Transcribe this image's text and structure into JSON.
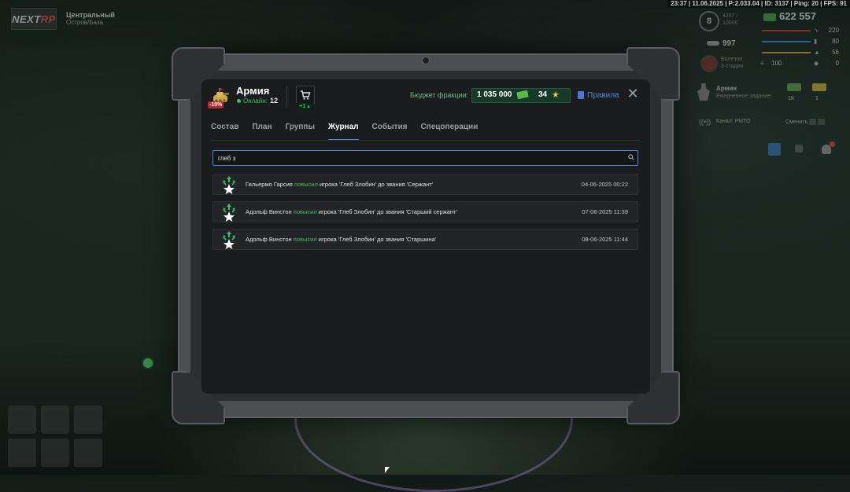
{
  "hud": {
    "top_strip": "23:37 | 11.06.2025 | P:2.033.04 | ID: 3137 | Ping: 20 | FPS: 91",
    "logo_main": "NEXT",
    "logo_accent": "RP",
    "zone_title": "Центральный",
    "zone_sub": "Остров/База",
    "level": "8",
    "xp_line1": "4207 /",
    "xp_line2": "10000",
    "money": "622 557",
    "rating": "997",
    "wanted_line1": "Болезни:",
    "wanted_line2": "3 стадия",
    "ammo": "100",
    "stats": [
      {
        "value": "220",
        "color": "#c43b3b",
        "icon": "heart-pulse-icon"
      },
      {
        "value": "80",
        "color": "#3b8fd0",
        "icon": "shield-bars-icon"
      },
      {
        "value": "56",
        "color": "#d0a43b",
        "icon": "food-icon"
      },
      {
        "value": "0",
        "color": "#8a8a8a",
        "icon": "armor-icon"
      }
    ],
    "fraction_name": "Армия",
    "fraction_task": "Ежедневное задание:",
    "reward1": "1K",
    "reward2": "1",
    "radio_label": "Канал: РМТО",
    "radio_switch": "Сменить"
  },
  "panel": {
    "faction_name": "Армия",
    "faction_discount": "-10%",
    "online_label": "Онлайн:",
    "online_count": "12",
    "cart_plus": "+1",
    "budget_label": "Бюджет фракции:",
    "budget_value": "1 035 000",
    "stars_value": "34",
    "rules_label": "Правила",
    "close_symbol": "✕",
    "colors": {
      "accent": "#4a86e0",
      "positive": "#3fbf5d",
      "discount": "#b8282f"
    }
  },
  "tabs": [
    {
      "label": "Состав"
    },
    {
      "label": "План"
    },
    {
      "label": "Группы"
    },
    {
      "label": "Журнал",
      "active": true
    },
    {
      "label": "События"
    },
    {
      "label": "Спецоперации"
    }
  ],
  "search": {
    "value": "глеб з"
  },
  "log": [
    {
      "actor": "Гильермо Гарсия",
      "action": "повысил",
      "rest": "игрока 'Глеб Злобин' до звания 'Сержант'",
      "date": "04-06-2025 00:22",
      "icon": "rank-up-icon"
    },
    {
      "actor": "Адольф Винстон",
      "action": "повысил",
      "rest": "игрока 'Глеб Злобин' до звания 'Старший сержант'",
      "date": "07-06-2025 11:39",
      "icon": "rank-up-icon"
    },
    {
      "actor": "Адольф Винстон",
      "action": "повысил",
      "rest": "игрока 'Глеб Злобин' до звания 'Старшина'",
      "date": "08-06-2025 11:44",
      "icon": "rank-up-icon"
    }
  ]
}
